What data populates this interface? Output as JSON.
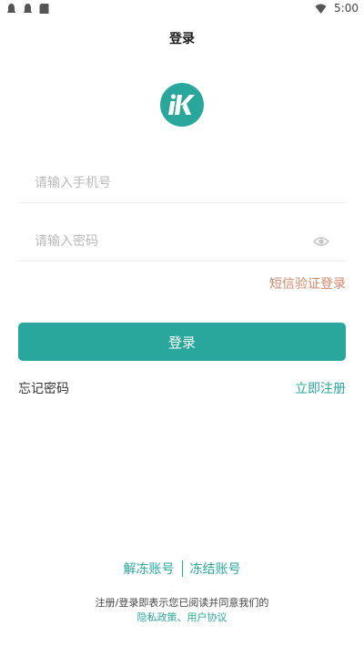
{
  "status_bar": {
    "time": "5:00",
    "left_icons": [
      "notification-icon",
      "notification-icon",
      "sd-card-icon"
    ],
    "wifi_icon": "wifi-icon"
  },
  "header": {
    "title": "登录"
  },
  "logo": {
    "icon": "app-logo-icon",
    "color": "#2aa79c"
  },
  "form": {
    "phone_placeholder": "请输入手机号",
    "password_placeholder": "请输入密码",
    "eye_icon": "eye-icon",
    "sms_login_label": "短信验证登录",
    "login_button_label": "登录"
  },
  "links": {
    "forgot_password": "忘记密码",
    "register": "立即注册"
  },
  "account": {
    "unfreeze": "解冻账号",
    "freeze": "冻结账号"
  },
  "agreement": {
    "text": "注册/登录即表示您已阅读并同意我们的",
    "privacy_policy": "隐私政策",
    "separator": "、",
    "user_agreement": "用户协议"
  },
  "colors": {
    "accent": "#2aa79c",
    "sms_link": "#d3886a"
  }
}
